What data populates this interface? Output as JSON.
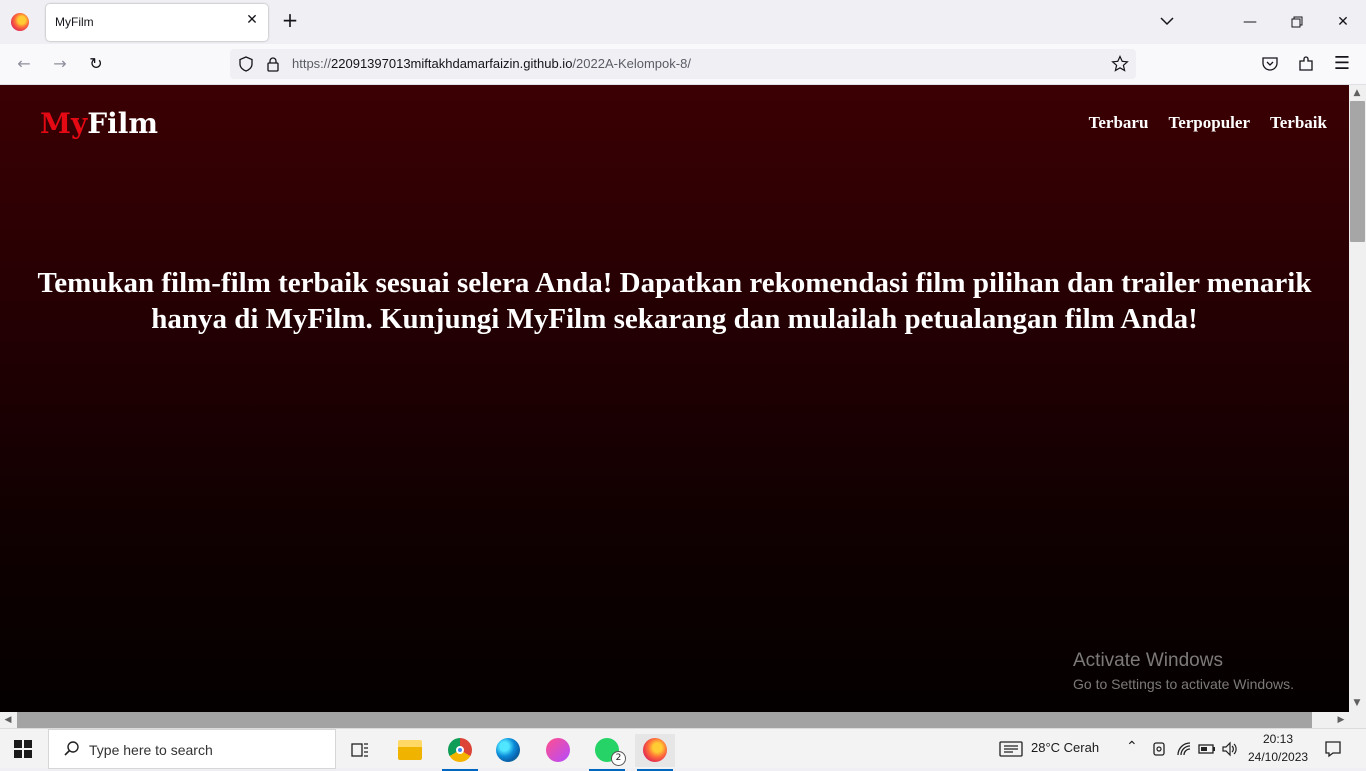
{
  "browser": {
    "tab_title": "MyFilm",
    "tab_close": "✕",
    "new_tab": "+",
    "url_prefix": "https://",
    "url_host": "22091397013miftakhdamarfaizin.github.io",
    "url_path": "/2022A-Kelompok-8/"
  },
  "site": {
    "logo_my": "My",
    "logo_film": "Film",
    "nav": [
      "Terbaru",
      "Terpopuler",
      "Terbaik"
    ],
    "hero_text": "Temukan film-film terbaik sesuai selera Anda! Dapatkan rekomendasi film pilihan dan trailer menarik hanya di MyFilm. Kunjungi MyFilm sekarang dan mulailah petualangan film Anda!",
    "accent_color": "#e50914"
  },
  "watermark": {
    "line1": "Activate Windows",
    "line2": "Go to Settings to activate Windows."
  },
  "taskbar": {
    "search_placeholder": "Type here to search",
    "whatsapp_badge": "2",
    "weather": "28°C  Cerah",
    "time": "20:13",
    "date": "24/10/2023"
  }
}
